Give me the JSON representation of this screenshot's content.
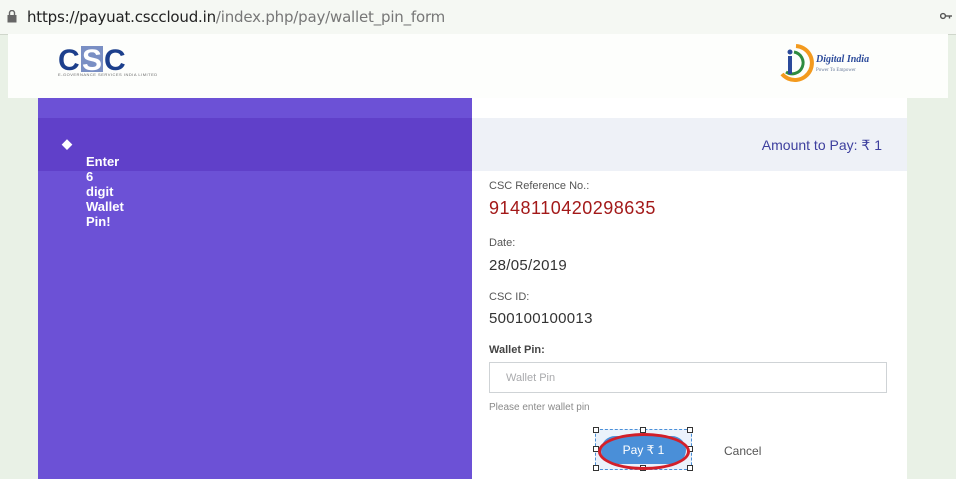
{
  "browser": {
    "url_host": "https://payuat.csccloud.in",
    "url_path": "/index.php/pay/wallet_pin_form"
  },
  "header": {
    "left_logo_text": "CSC",
    "left_logo_tagline": "e-Governance Services India Limited",
    "right_logo_title": "Digital India",
    "right_logo_subtitle": "Power To Empower"
  },
  "left_panel": {
    "instruction": "Enter 6 digit Wallet Pin!"
  },
  "payment": {
    "amount_label": "Amount to Pay:  ₹ 1",
    "ref_label": "CSC Reference No.:",
    "ref_value": "9148110420298635",
    "date_label": "Date:",
    "date_value": "28/05/2019",
    "cscid_label": "CSC ID:",
    "cscid_value": "500100100013",
    "pin_label": "Wallet Pin:",
    "pin_placeholder": "Wallet Pin",
    "pin_help": "Please enter wallet pin",
    "pay_label": "Pay  ₹ 1",
    "cancel_label": "Cancel"
  },
  "colors": {
    "left_panel": "#6c51d6",
    "left_header": "#6040c9",
    "reference_red": "#a31919",
    "pay_button": "#4a8fd8",
    "highlight_ring": "#d21f2a"
  }
}
